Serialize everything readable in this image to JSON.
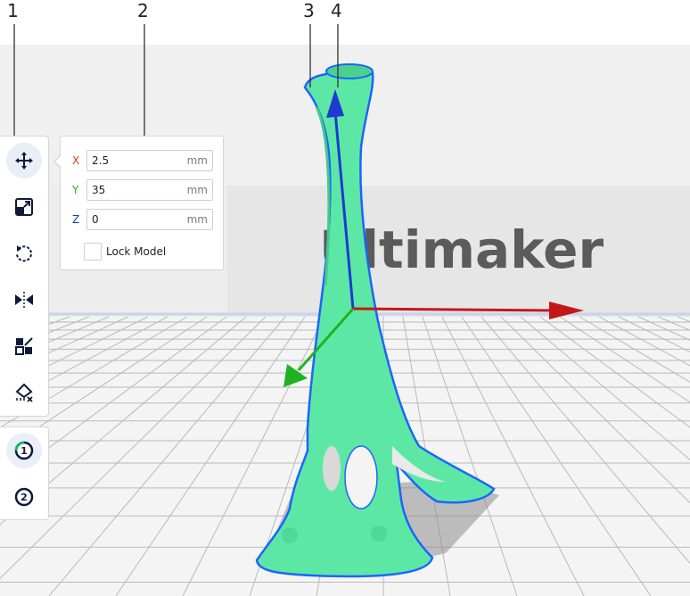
{
  "callouts": [
    "1",
    "2",
    "3",
    "4"
  ],
  "viewport": {
    "backdrop_text": "Ultimaker",
    "bed_color": "#f1f1f1",
    "model_color": "#5ce8a4",
    "outline_color": "#1d64ff"
  },
  "toolbar": {
    "tools": [
      {
        "name": "move-icon",
        "active": true
      },
      {
        "name": "scale-icon",
        "active": false
      },
      {
        "name": "rotate-icon",
        "active": false
      },
      {
        "name": "mirror-icon",
        "active": false
      },
      {
        "name": "per-model-settings-icon",
        "active": false
      },
      {
        "name": "support-blocker-icon",
        "active": false
      }
    ],
    "extruders": [
      "1",
      "2"
    ]
  },
  "move_panel": {
    "x": {
      "axis": "X",
      "value": "2.5",
      "unit": "mm",
      "color": "#d03a1c"
    },
    "y": {
      "axis": "Y",
      "value": "35",
      "unit": "mm",
      "color": "#1fb31f"
    },
    "z": {
      "axis": "Z",
      "value": "0",
      "unit": "mm",
      "color": "#1e3ad0"
    },
    "lock_label": "Lock Model",
    "lock_checked": false
  }
}
